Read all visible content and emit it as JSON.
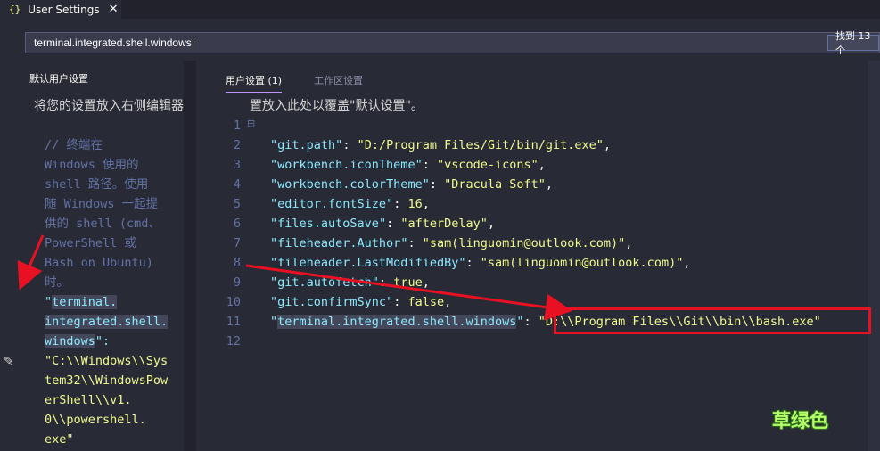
{
  "tab": {
    "icon": "{}",
    "title": "User Settings",
    "close": "✕"
  },
  "search": {
    "value": "terminal.integrated.shell.windows",
    "count": "找到 13 个"
  },
  "left": {
    "header": "默认用户设置",
    "hint": "将您的设置放入右侧编辑器",
    "lines": [
      "// 终端在",
      "Windows 使用的",
      "shell 路径。使用",
      "随 Windows 一起提",
      "供的 shell (cmd、",
      "PowerShell 或",
      "Bash on Ubuntu)",
      "时。"
    ],
    "key_parts": [
      "terminal.",
      "integrated.shell.",
      "windows"
    ],
    "value_lines": [
      "\"C:\\\\Windows\\\\Sys",
      "tem32\\\\WindowsPow",
      "erShell\\\\v1.",
      "0\\\\powershell.",
      "exe\""
    ]
  },
  "right": {
    "tabs": [
      {
        "label": "用户设置 (1)",
        "active": true
      },
      {
        "label": "工作区设置",
        "active": false
      }
    ],
    "hint": "置放入此处以覆盖\"默认设置\"。",
    "line_numbers": [
      "1",
      "2",
      "3",
      "4",
      "5",
      "6",
      "7",
      "8",
      "9",
      "10",
      "11",
      "12"
    ],
    "settings": [
      {
        "key": "git.path",
        "value": "\"D:/Program Files/Git/bin/git.exe\""
      },
      {
        "key": "workbench.iconTheme",
        "value": "\"vscode-icons\""
      },
      {
        "key": "workbench.colorTheme",
        "value": "\"Dracula Soft\""
      },
      {
        "key": "editor.fontSize",
        "value": "16"
      },
      {
        "key": "files.autoSave",
        "value": "\"afterDelay\""
      },
      {
        "key": "fileheader.Author",
        "value": "\"sam(linguomin@outlook.com)\""
      },
      {
        "key": "fileheader.LastModifiedBy",
        "value": "\"sam(linguomin@outlook.com)\""
      },
      {
        "key": "git.autofetch",
        "value": "true"
      },
      {
        "key": "git.confirmSync",
        "value": "false"
      },
      {
        "key": "terminal.integrated.shell.windows",
        "value": "\"D:\\\\Program Files\\\\Git\\\\bin\\\\bash.exe\""
      }
    ]
  },
  "watermark": "草绿色",
  "colors": {
    "background": "#282a36",
    "string": "#f1fa8c",
    "key": "#8be9fd",
    "comment": "#6272a4",
    "annotation": "#e81123"
  }
}
